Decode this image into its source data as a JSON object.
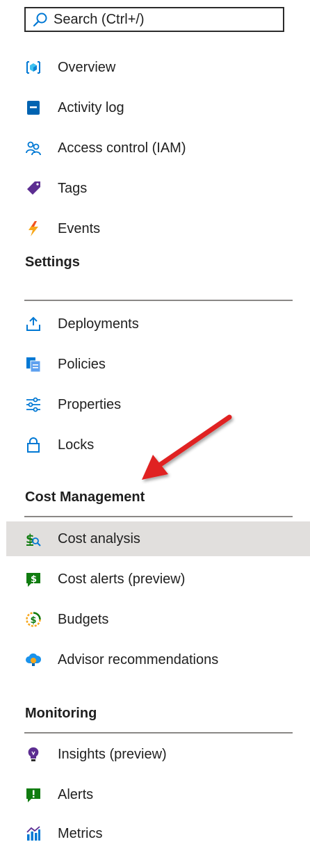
{
  "search": {
    "placeholder": "Search (Ctrl+/)"
  },
  "top_items": [
    {
      "label": "Overview",
      "icon": "overview-cube-icon"
    },
    {
      "label": "Activity log",
      "icon": "activity-log-icon"
    },
    {
      "label": "Access control (IAM)",
      "icon": "people-icon"
    },
    {
      "label": "Tags",
      "icon": "tag-icon"
    },
    {
      "label": "Events",
      "icon": "lightning-icon"
    }
  ],
  "sections": [
    {
      "title": "Settings",
      "items": [
        {
          "label": "Deployments",
          "icon": "upload-icon"
        },
        {
          "label": "Policies",
          "icon": "policy-document-icon"
        },
        {
          "label": "Properties",
          "icon": "sliders-icon"
        },
        {
          "label": "Locks",
          "icon": "lock-icon"
        }
      ]
    },
    {
      "title": "Cost Management",
      "items": [
        {
          "label": "Cost analysis",
          "icon": "cost-analysis-icon",
          "selected": true
        },
        {
          "label": "Cost alerts (preview)",
          "icon": "cost-alert-icon"
        },
        {
          "label": "Budgets",
          "icon": "budget-icon"
        },
        {
          "label": "Advisor recommendations",
          "icon": "advisor-icon"
        }
      ]
    },
    {
      "title": "Monitoring",
      "items": [
        {
          "label": "Insights (preview)",
          "icon": "lightbulb-icon"
        },
        {
          "label": "Alerts",
          "icon": "alert-icon"
        },
        {
          "label": "Metrics",
          "icon": "metrics-icon"
        }
      ]
    }
  ],
  "annotation": {
    "arrow_color": "#e02020",
    "points_to": "Cost Management"
  },
  "colors": {
    "selected_background": "#e1dfdd",
    "azure_blue": "#0078d4",
    "green": "#107c10",
    "purple": "#5c2d91"
  }
}
